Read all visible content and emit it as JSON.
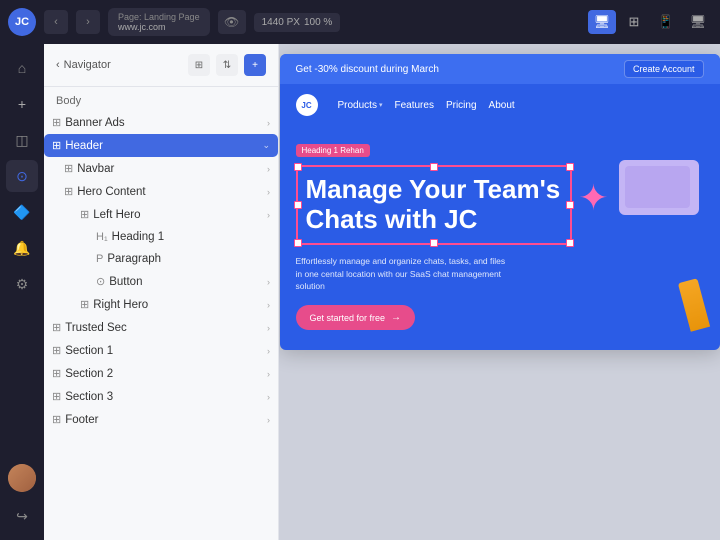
{
  "topbar": {
    "logo": "JC",
    "back_btn": "‹",
    "forward_btn": "›",
    "page_label": "Page: Landing Page",
    "page_url": "www.jc.com",
    "resolution": "1440 PX",
    "zoom": "100 %",
    "device_desktop": "🖥",
    "device_tablet": "⊞",
    "device_mobile": "📱",
    "device_tv": "📺"
  },
  "sidebar_icons": {
    "home": "⌂",
    "add": "+",
    "layers": "◫",
    "components": "⊙",
    "settings": "⚙",
    "bell": "🔔",
    "gear": "⚙"
  },
  "navigator": {
    "title": "Navigator",
    "back_icon": "‹",
    "body_label": "Body",
    "items": [
      {
        "id": "banner-ads",
        "label": "Banner Ads",
        "indent": 0,
        "icon": "▦",
        "hasArrow": true,
        "active": false
      },
      {
        "id": "header",
        "label": "Header",
        "indent": 0,
        "icon": "▦",
        "hasArrow": true,
        "active": true
      },
      {
        "id": "navbar",
        "label": "Navbar",
        "indent": 1,
        "icon": "▦",
        "hasArrow": true,
        "active": false
      },
      {
        "id": "hero-content",
        "label": "Hero Content",
        "indent": 1,
        "icon": "▦",
        "hasArrow": true,
        "active": false
      },
      {
        "id": "left-hero",
        "label": "Left Hero",
        "indent": 2,
        "icon": "▦",
        "hasArrow": true,
        "active": false
      },
      {
        "id": "heading-1",
        "label": "Heading 1",
        "indent": 3,
        "icon": "H",
        "hasArrow": false,
        "active": false
      },
      {
        "id": "paragraph",
        "label": "Paragraph",
        "indent": 3,
        "icon": "P",
        "hasArrow": false,
        "active": false
      },
      {
        "id": "button",
        "label": "Button",
        "indent": 3,
        "icon": "⊙",
        "hasArrow": true,
        "active": false
      },
      {
        "id": "right-hero",
        "label": "Right Hero",
        "indent": 2,
        "icon": "▦",
        "hasArrow": true,
        "active": false
      },
      {
        "id": "trusted-sec",
        "label": "Trusted Sec",
        "indent": 0,
        "icon": "▦",
        "hasArrow": true,
        "active": false
      },
      {
        "id": "section-1",
        "label": "Section 1",
        "indent": 0,
        "icon": "▦",
        "hasArrow": true,
        "active": false
      },
      {
        "id": "section-2",
        "label": "Section 2",
        "indent": 0,
        "icon": "▦",
        "hasArrow": true,
        "active": false
      },
      {
        "id": "section-3",
        "label": "Section 3",
        "indent": 0,
        "icon": "▦",
        "hasArrow": true,
        "active": false
      },
      {
        "id": "footer",
        "label": "Footer",
        "indent": 0,
        "icon": "▦",
        "hasArrow": true,
        "active": false
      }
    ]
  },
  "website": {
    "promo_text": "Get -30% discount during March",
    "promo_btn": "Create Account",
    "logo": "JC",
    "nav_items": [
      {
        "label": "Products",
        "hasDropdown": true
      },
      {
        "label": "Features",
        "hasDropdown": false
      },
      {
        "label": "Pricing",
        "hasDropdown": false
      },
      {
        "label": "About",
        "hasDropdown": false
      }
    ],
    "heading_badge": "Heading 1 Rehan",
    "hero_heading": "Manage Your Team's Chats with JC",
    "hero_subtext": "Effortlessly manage and organize chats, tasks, and files in one cental location with our SaaS chat management solution",
    "cta_btn": "Get started for free",
    "cta_arrow": "→"
  }
}
